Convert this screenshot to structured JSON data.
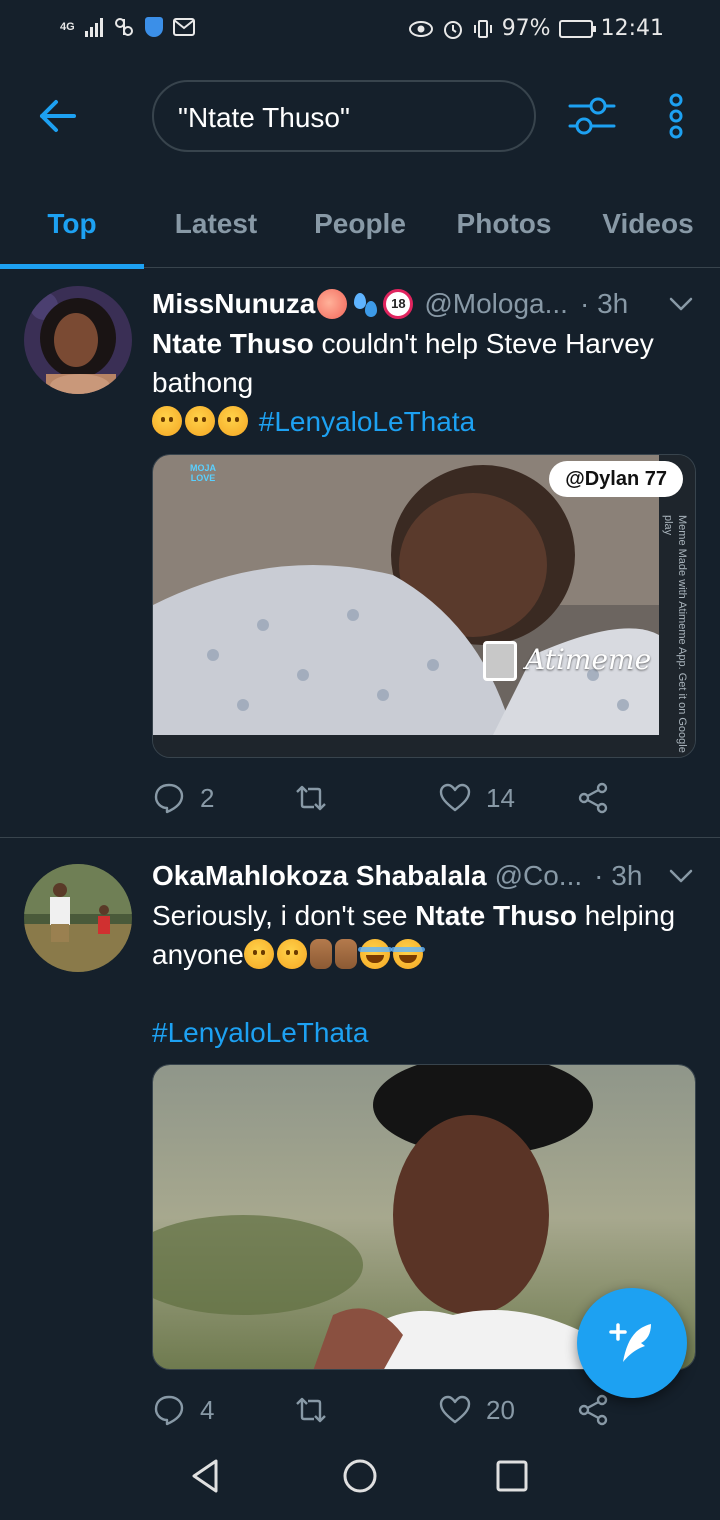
{
  "status_bar": {
    "network": "4G",
    "battery": "97%",
    "time": "12:41"
  },
  "search": {
    "query": "\"Ntate Thuso\""
  },
  "tabs": [
    {
      "label": "Top",
      "active": true
    },
    {
      "label": "Latest",
      "active": false
    },
    {
      "label": "People",
      "active": false
    },
    {
      "label": "Photos",
      "active": false
    },
    {
      "label": "Videos",
      "active": false
    }
  ],
  "tweets": [
    {
      "author": "MissNunuza",
      "handle": "@Mologa...",
      "time": "· 3h",
      "text_bold": "Ntate Thuso",
      "text_rest": " couldn't help Steve Harvey bathong",
      "hashtag": "#LenyaloLeThata",
      "media": {
        "tag": "@Dylan 77",
        "watermark": "Atimeme",
        "side_credit": "Meme Made with Atimeme App. Get it on Google play",
        "corner_logo": "MOJA LOVE"
      },
      "replies": "2",
      "retweets": "",
      "likes": "14"
    },
    {
      "author": "OkaMahlokoza Shabalala",
      "handle": "@Co...",
      "time": "· 3h",
      "text_start": "Seriously, i don't see ",
      "text_bold": "Ntate Thuso",
      "text_rest": " helping anyone",
      "hashtag": "#LenyaloLeThata",
      "replies": "4",
      "retweets": "",
      "likes": "20"
    }
  ],
  "colors": {
    "background": "#15202b",
    "accent": "#1da1f2",
    "muted": "#8899a6",
    "divider": "#38444d"
  },
  "icons": {
    "back": "arrow-left-icon",
    "filter": "sliders-icon",
    "more": "vertical-dots-icon",
    "reply": "speech-bubble-icon",
    "retweet": "retweet-icon",
    "like": "heart-icon",
    "share": "share-icon",
    "compose": "feather-plus-icon"
  }
}
